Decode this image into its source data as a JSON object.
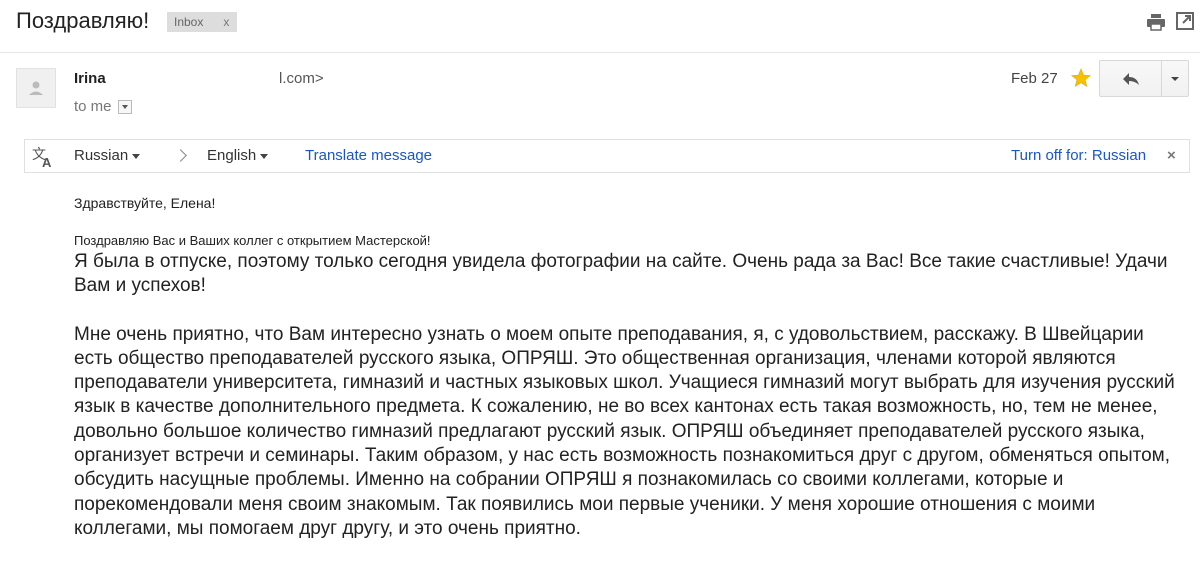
{
  "subject": "Поздравляю!",
  "label": {
    "text": "Inbox",
    "remove": "x"
  },
  "icons": {
    "print": "print-icon",
    "popout": "open-in-new-window-icon",
    "star": "star-icon",
    "reply": "reply-icon",
    "translate": "translate-icon",
    "avatar": "person-icon"
  },
  "colors": {
    "link": "#1a56c4",
    "star": "#f7c100",
    "label_bg": "#dddddd"
  },
  "message": {
    "sender_name": "Irina",
    "sender_email": "l.com>",
    "recipient": "to me",
    "date": "Feb 27"
  },
  "translate_bar": {
    "source_language": "Russian",
    "target_language": "English",
    "action": "Translate message",
    "turn_off": "Turn off for: Russian",
    "close": "×"
  },
  "body": {
    "greeting": "Здравствуйте, Елена!",
    "congrats": "Поздравляю Вас и Ваших коллег с открытием Мастерской!",
    "paragraph1": "Я была в отпуске, поэтому  только сегодня увидела фотографии на сайте. Очень рада за Вас! Все такие счастливые! Удачи Вам и успехов!",
    "paragraph2": "Мне очень приятно, что Вам интересно узнать о моем опыте преподавания, я, с удовольствием, расскажу. В Швейцарии есть общество преподавателей русского языка, ОПРЯШ. Это общественная организация, членами которой являются преподаватели университета, гимназий и  частных языковых школ. Учащиеся гимназий могут выбрать для изучения русский язык в качестве дополнительного предмета. К сожалению, не во всех кантонах есть такая возможность, но, тем не менее, довольно большое количество гимназий предлагают русский язык. ОПРЯШ объединяет преподавателей русского языка, организует встречи и семинары. Таким образом, у нас есть возможность познакомиться друг с другом, обменяться опытом, обсудить насущные проблемы. Именно на собрании ОПРЯШ я познакомилась со своими коллегами, которые и порекомендовали меня своим знакомым. Так появились мои первые ученики. У меня хорошие отношения с моими коллегами, мы помогаем друг другу, и это очень приятно."
  }
}
